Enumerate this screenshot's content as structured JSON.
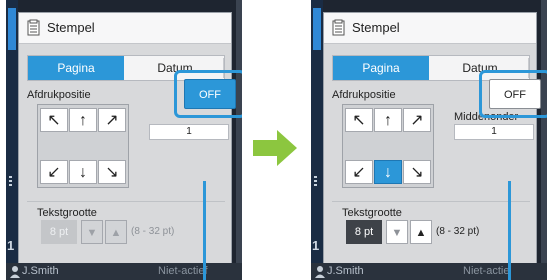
{
  "left_screen": {
    "title": "Stempel",
    "tabs": [
      {
        "label": "Pagina",
        "selected": true
      },
      {
        "label": "Datum",
        "selected": false
      }
    ],
    "position_label": "Afdrukpositie",
    "position_name": "",
    "position_value": "1",
    "selected_cell": "none",
    "toggle_label": "OFF",
    "toggle_state": "highlighted",
    "text_size_label": "Tekstgrootte",
    "text_size_value": "8 pt",
    "text_size_range": "(8 - 32 pt)",
    "text_size_enabled": false,
    "user_name": "J.Smith",
    "status": "Niet-actief"
  },
  "right_screen": {
    "title": "Stempel",
    "tabs": [
      {
        "label": "Pagina",
        "selected": true
      },
      {
        "label": "Datum",
        "selected": false
      }
    ],
    "position_label": "Afdrukpositie",
    "position_name": "Middenonder",
    "position_value": "1",
    "selected_cell": "bottom-center",
    "toggle_label": "OFF",
    "toggle_state": "normal",
    "text_size_label": "Tekstgrootte",
    "text_size_value": "8 pt",
    "text_size_range": "(8 - 32 pt)",
    "text_size_enabled": true,
    "user_name": "J.Smith",
    "status": "Niet-actie"
  },
  "arrows": {
    "top": [
      "up-left-arrow",
      "up-arrow",
      "up-right-arrow"
    ],
    "bottom": [
      "down-left-arrow",
      "down-arrow",
      "down-right-arrow"
    ]
  },
  "colors": {
    "accent": "#2c97d8",
    "flow_arrow": "#8cc63f",
    "device_bg": "#1e2530"
  }
}
